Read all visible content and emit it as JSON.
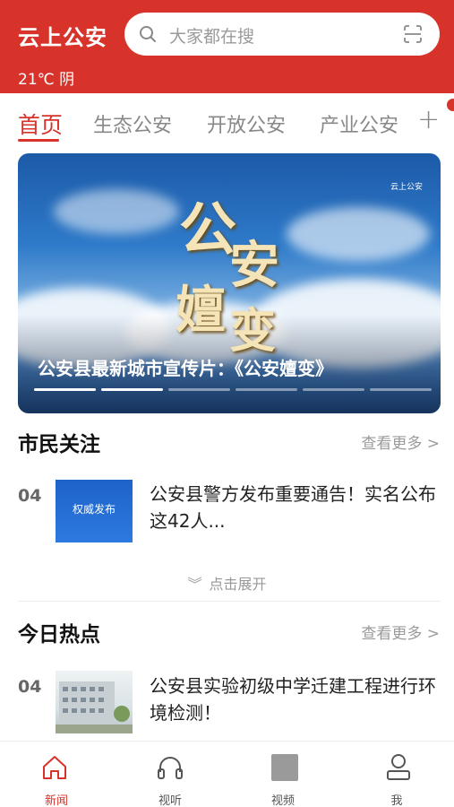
{
  "header": {
    "app_title": "云上公安",
    "search_placeholder": "大家都在搜",
    "weather": "21℃  阴",
    "brand_color": "#d8332b"
  },
  "tabs": [
    {
      "label": "首页",
      "active": true
    },
    {
      "label": "生态公安",
      "active": false
    },
    {
      "label": "开放公安",
      "active": false
    },
    {
      "label": "产业公安",
      "active": false
    }
  ],
  "tabs_add_icon": "plus-icon",
  "banner": {
    "calligraphy": [
      "公",
      "安",
      "嬗",
      "变"
    ],
    "logo_text": "云上公安",
    "caption": "公安县最新城市宣传片：《公安嬗变》",
    "slides": 6,
    "active_slide": 2
  },
  "citizen_focus": {
    "title": "市民关注",
    "more": "查看更多 >",
    "items": [
      {
        "num": "04",
        "thumb_text": "权威发布",
        "text": "公安县警方发布重要通告！实名公布这42人..."
      }
    ],
    "expand": "点击展开"
  },
  "hot_today": {
    "title": "今日热点",
    "more": "查看更多 >",
    "items": [
      {
        "num": "04",
        "text": "公安县实验初级中学迁建工程进行环境检测！"
      }
    ]
  },
  "bottom_nav": [
    {
      "label": "新闻",
      "icon": "home-icon",
      "active": true
    },
    {
      "label": "视听",
      "icon": "headphones-icon",
      "active": false
    },
    {
      "label": "视频",
      "icon": "video-icon",
      "active": false
    },
    {
      "label": "我",
      "icon": "user-icon",
      "active": false
    }
  ]
}
